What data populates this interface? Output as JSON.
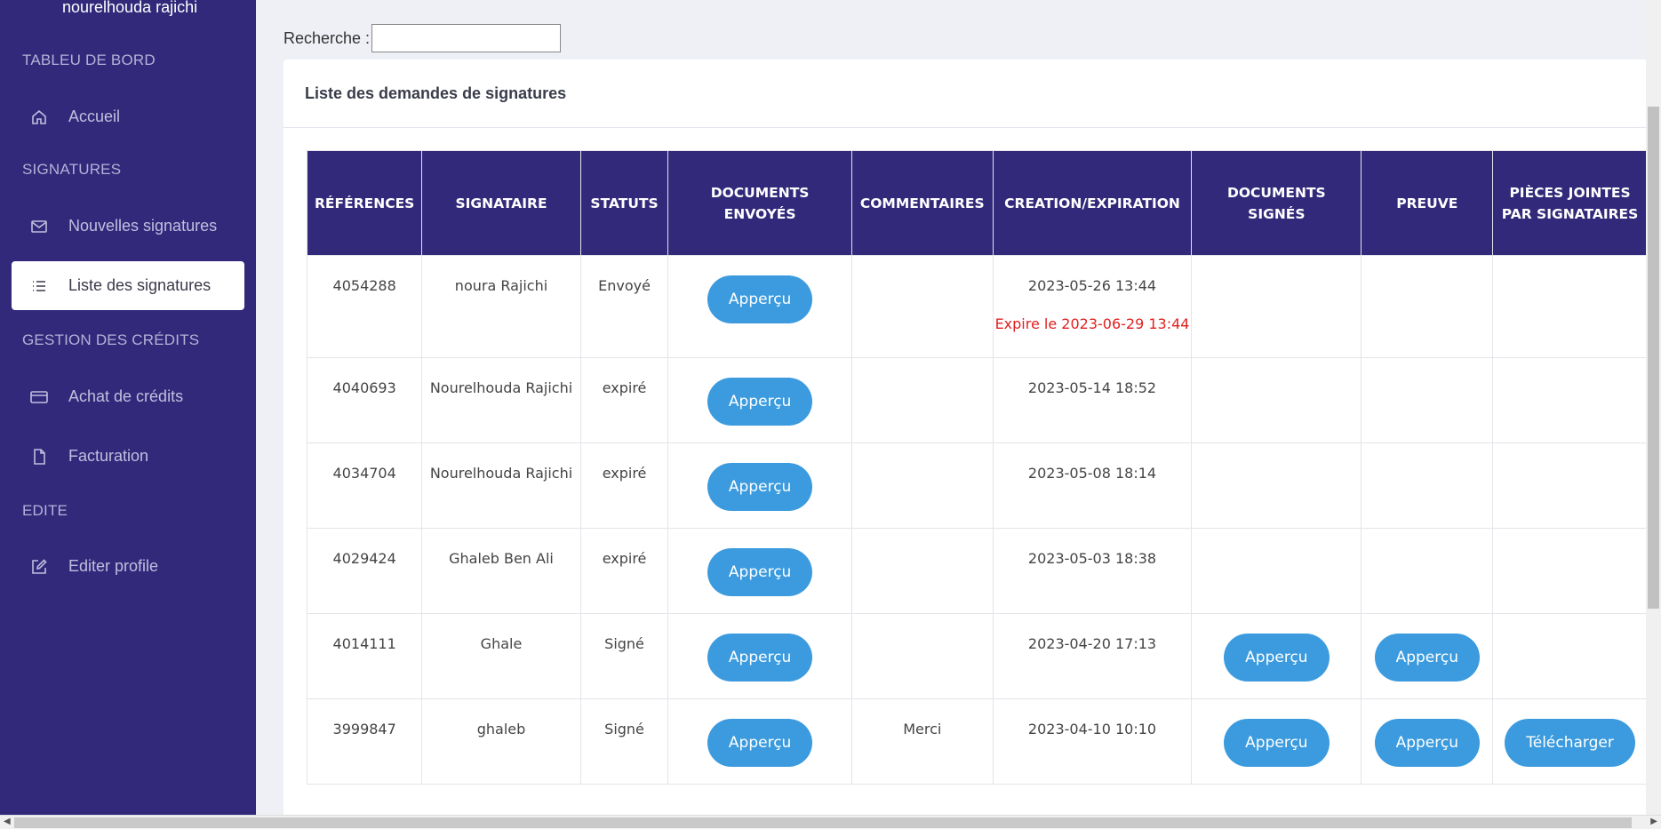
{
  "sidebar": {
    "user_name": "nourelhouda rajichi",
    "sections": [
      {
        "title": "TABLEU DE BORD"
      },
      {
        "title": "SIGNATURES"
      },
      {
        "title": "GESTION DES CRÉDITS"
      },
      {
        "title": "EDITE"
      }
    ],
    "items": [
      {
        "label": "Accueil",
        "icon": "home-icon"
      },
      {
        "label": "Nouvelles signatures",
        "icon": "mail-icon"
      },
      {
        "label": "Liste des signatures",
        "icon": "list-icon",
        "active": true
      },
      {
        "label": "Achat de crédits",
        "icon": "credit-card-icon"
      },
      {
        "label": "Facturation",
        "icon": "file-icon"
      },
      {
        "label": "Editer profile",
        "icon": "edit-icon"
      }
    ]
  },
  "search": {
    "label": "Recherche :",
    "value": ""
  },
  "card": {
    "title": "Liste des demandes de signatures"
  },
  "table": {
    "headers": [
      "RÉFÉRENCES",
      "SIGNATAIRE",
      "STATUTS",
      "DOCUMENTS ENVOYÉS",
      "COMMENTAIRES",
      "CREATION/EXPIRATION",
      "DOCUMENTS SIGNÉS",
      "PREUVE",
      "PIÈCES JOINTES PAR SIGNATAIRES"
    ],
    "rows": [
      {
        "ref": "4054288",
        "signer": "noura Rajichi",
        "status": "Envoyé",
        "doc_btn": "Apperçu",
        "comment": "",
        "created": "2023-05-26 13:44",
        "expire": "Expire le 2023-06-29 13:44",
        "signed_btn": "",
        "proof_btn": "",
        "attach_btn": ""
      },
      {
        "ref": "4040693",
        "signer": "Nourelhouda Rajichi",
        "status": "expiré",
        "doc_btn": "Apperçu",
        "comment": "",
        "created": "2023-05-14 18:52",
        "expire": "",
        "signed_btn": "",
        "proof_btn": "",
        "attach_btn": ""
      },
      {
        "ref": "4034704",
        "signer": "Nourelhouda Rajichi",
        "status": "expiré",
        "doc_btn": "Apperçu",
        "comment": "",
        "created": "2023-05-08 18:14",
        "expire": "",
        "signed_btn": "",
        "proof_btn": "",
        "attach_btn": ""
      },
      {
        "ref": "4029424",
        "signer": "Ghaleb Ben Ali",
        "status": "expiré",
        "doc_btn": "Apperçu",
        "comment": "",
        "created": "2023-05-03 18:38",
        "expire": "",
        "signed_btn": "",
        "proof_btn": "",
        "attach_btn": ""
      },
      {
        "ref": "4014111",
        "signer": "Ghale",
        "status": "Signé",
        "doc_btn": "Apperçu",
        "comment": "",
        "created": "2023-04-20 17:13",
        "expire": "",
        "signed_btn": "Apperçu",
        "proof_btn": "Apperçu",
        "attach_btn": ""
      },
      {
        "ref": "3999847",
        "signer": "ghaleb",
        "status": "Signé",
        "doc_btn": "Apperçu",
        "comment": "Merci",
        "created": "2023-04-10 10:10",
        "expire": "",
        "signed_btn": "Apperçu",
        "proof_btn": "Apperçu",
        "attach_btn": "Télécharger"
      }
    ]
  },
  "colors": {
    "sidebar_bg": "#32297a",
    "header_bg": "#32297a",
    "button_bg": "#3b9bde",
    "expire_text": "#e02020"
  }
}
